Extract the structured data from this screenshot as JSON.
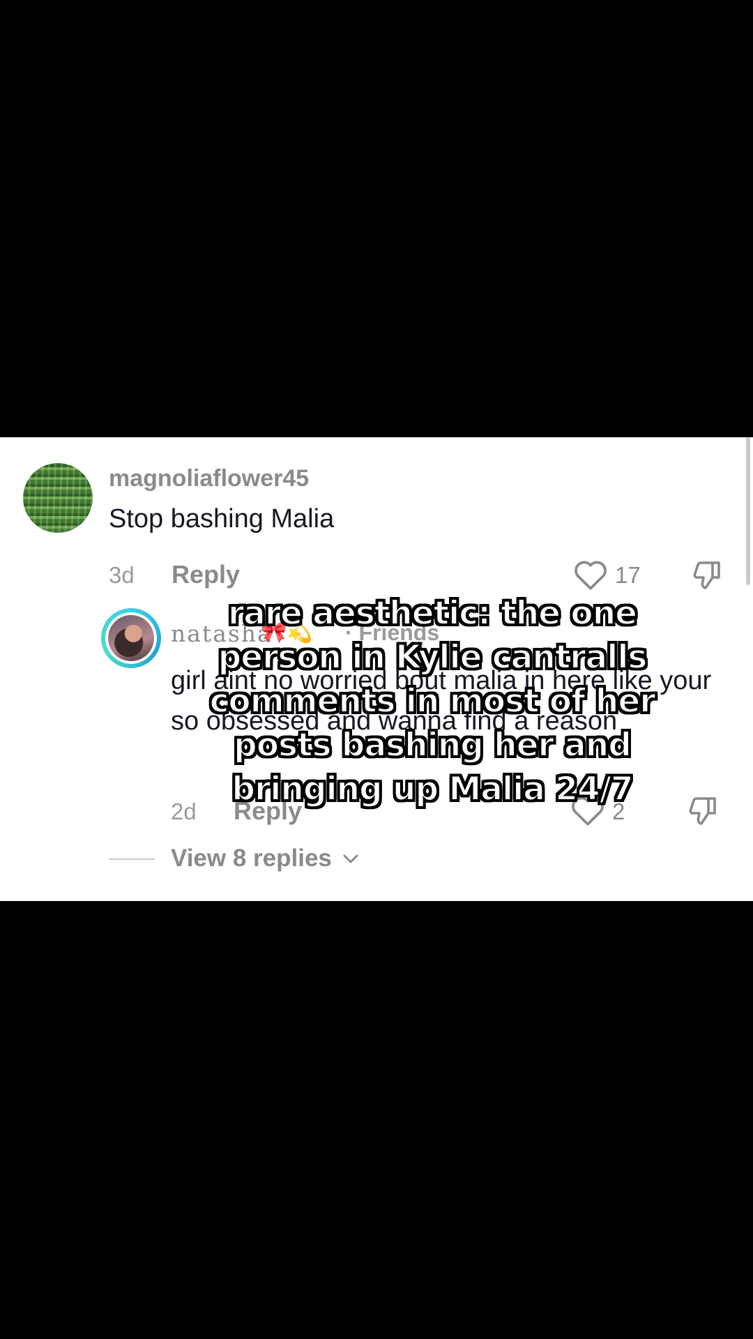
{
  "comment": {
    "username": "magnoliaflower45",
    "text": "Stop bashing Malia",
    "time": "3d",
    "reply_label": "Reply",
    "likes": "17"
  },
  "reply": {
    "username": "natasha",
    "emojis": "🎀💫",
    "badge": "· Friends",
    "text": "girl aint no worried bout malia in here like your so obsessed and wanna find a reason",
    "time": "2d",
    "reply_label": "Reply",
    "likes": "2"
  },
  "view_replies": "View 8 replies",
  "overlay_text": "rare aesthetic: the one person in Kylie cantralls comments in most of her posts bashing her and bringing up Malia 24/7",
  "colors": {
    "panel_bg": "#ffffff",
    "page_bg": "#000000",
    "muted_text": "#8a8a8a",
    "primary_text": "#161823",
    "avatar_ring": "#3ad1e6"
  }
}
